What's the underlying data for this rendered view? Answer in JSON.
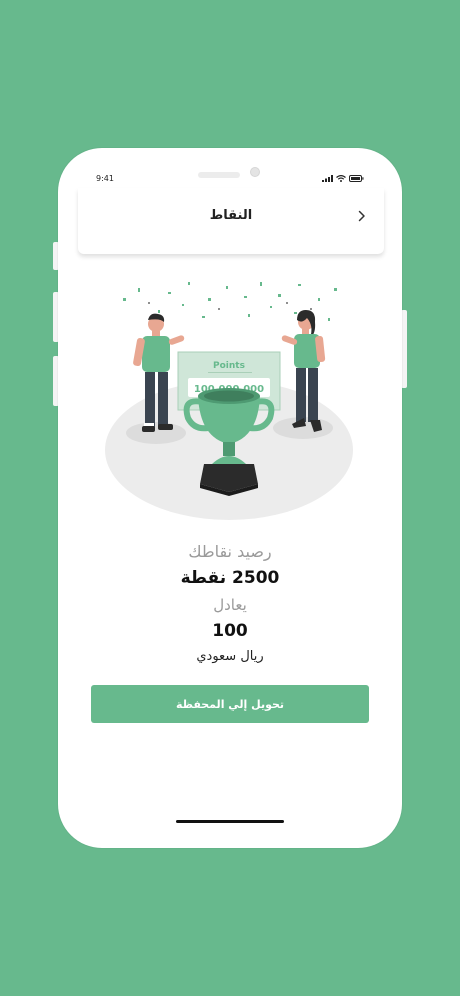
{
  "status_bar": {
    "time": "9:41"
  },
  "header": {
    "title": "النقاط",
    "back_icon": "chevron-right-icon"
  },
  "illustration": {
    "card_title": "Points",
    "card_value": "100.000.000",
    "icon": "trophy-illustration"
  },
  "balance": {
    "label": "رصيد نقاطك",
    "points": "2500 نقطة",
    "equals_label": "يعادل",
    "amount": "100",
    "currency": "ريال سعودي"
  },
  "actions": {
    "transfer_label": "تحويل إلي المحفظة"
  },
  "colors": {
    "accent": "#67b98d",
    "background": "#67b98d"
  }
}
